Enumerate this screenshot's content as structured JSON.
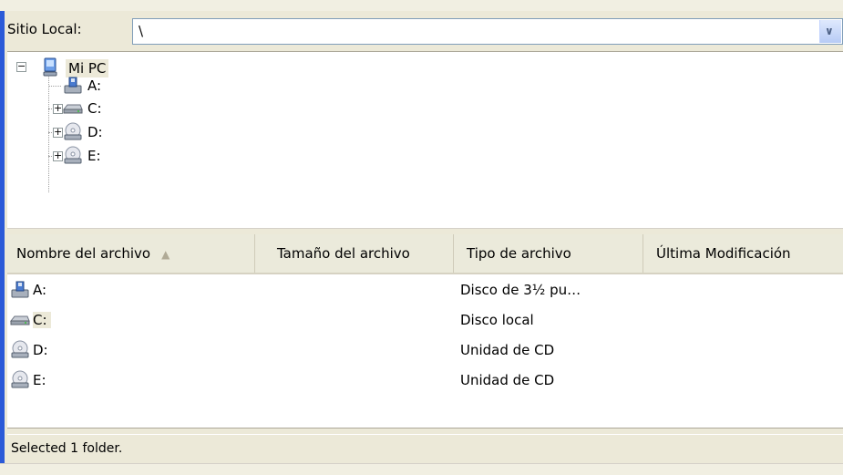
{
  "site_bar": {
    "label": "Sitio Local:",
    "path_value": "\\"
  },
  "tree": {
    "root": {
      "label": "Mi PC",
      "icon": "my-computer-icon",
      "expanded": true
    },
    "children": [
      {
        "label": "A:",
        "icon": "floppy-drive-icon",
        "has_children": false
      },
      {
        "label": "C:",
        "icon": "hard-drive-icon",
        "has_children": true
      },
      {
        "label": "D:",
        "icon": "cd-drive-icon",
        "has_children": true
      },
      {
        "label": "E:",
        "icon": "cd-drive-icon",
        "has_children": true
      }
    ]
  },
  "list": {
    "columns": [
      "Nombre del archivo",
      "Tamaño del archivo",
      "Tipo de archivo",
      "Última Modificación"
    ],
    "sort_indicator": "▲",
    "rows": [
      {
        "name": "A:",
        "type": "Disco de 3½ pu…",
        "icon": "floppy-drive-icon"
      },
      {
        "name": "C:",
        "type": "Disco local",
        "icon": "hard-drive-icon",
        "selected": true
      },
      {
        "name": "D:",
        "type": "Unidad de CD",
        "icon": "cd-drive-icon"
      },
      {
        "name": "E:",
        "type": "Unidad de CD",
        "icon": "cd-drive-icon"
      }
    ]
  },
  "status": {
    "text": "Selected 1 folder."
  },
  "colors": {
    "accent_blue": "#2b5ad8",
    "chrome": "#ece9d8",
    "header": "#ebeadb"
  }
}
